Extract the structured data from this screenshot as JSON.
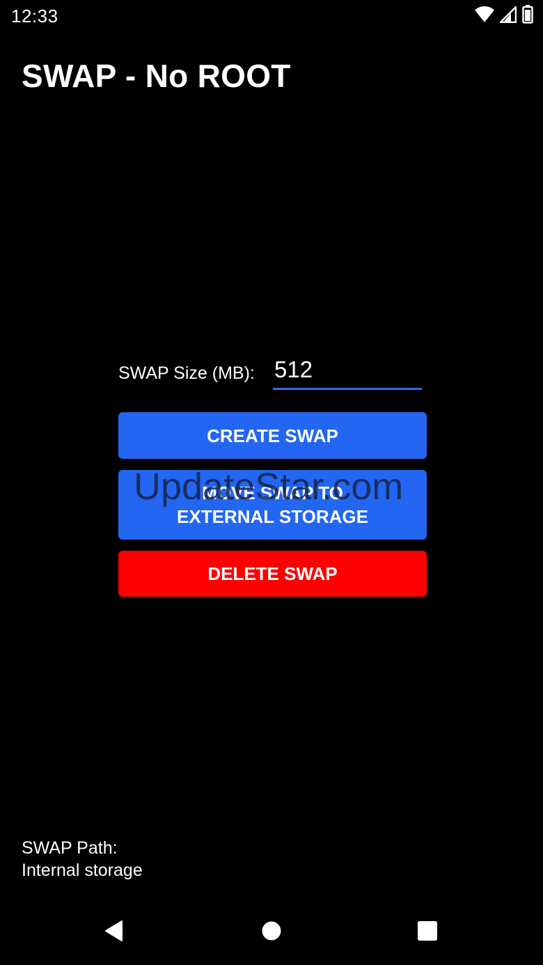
{
  "status_bar": {
    "time": "12:33",
    "icons": [
      "wifi-icon",
      "cell-signal-icon",
      "battery-icon"
    ]
  },
  "app": {
    "title": "SWAP - No ROOT"
  },
  "swap_size": {
    "label": "SWAP Size (MB):",
    "value": "512"
  },
  "buttons": {
    "create": "CREATE SWAP",
    "move_line1": "MOVE SWAP TO",
    "move_line2": "EXTERNAL STORAGE",
    "delete": "DELETE SWAP"
  },
  "watermark": "UpdateStar.com",
  "swap_path": {
    "label": "SWAP Path:",
    "value": "Internal storage"
  },
  "nav": {
    "icons": [
      "back-icon",
      "home-icon",
      "recents-icon"
    ]
  },
  "colors": {
    "background": "#000000",
    "primary_button": "#2266f2",
    "danger_button": "#ff0000",
    "input_underline": "#2f6fe8"
  }
}
